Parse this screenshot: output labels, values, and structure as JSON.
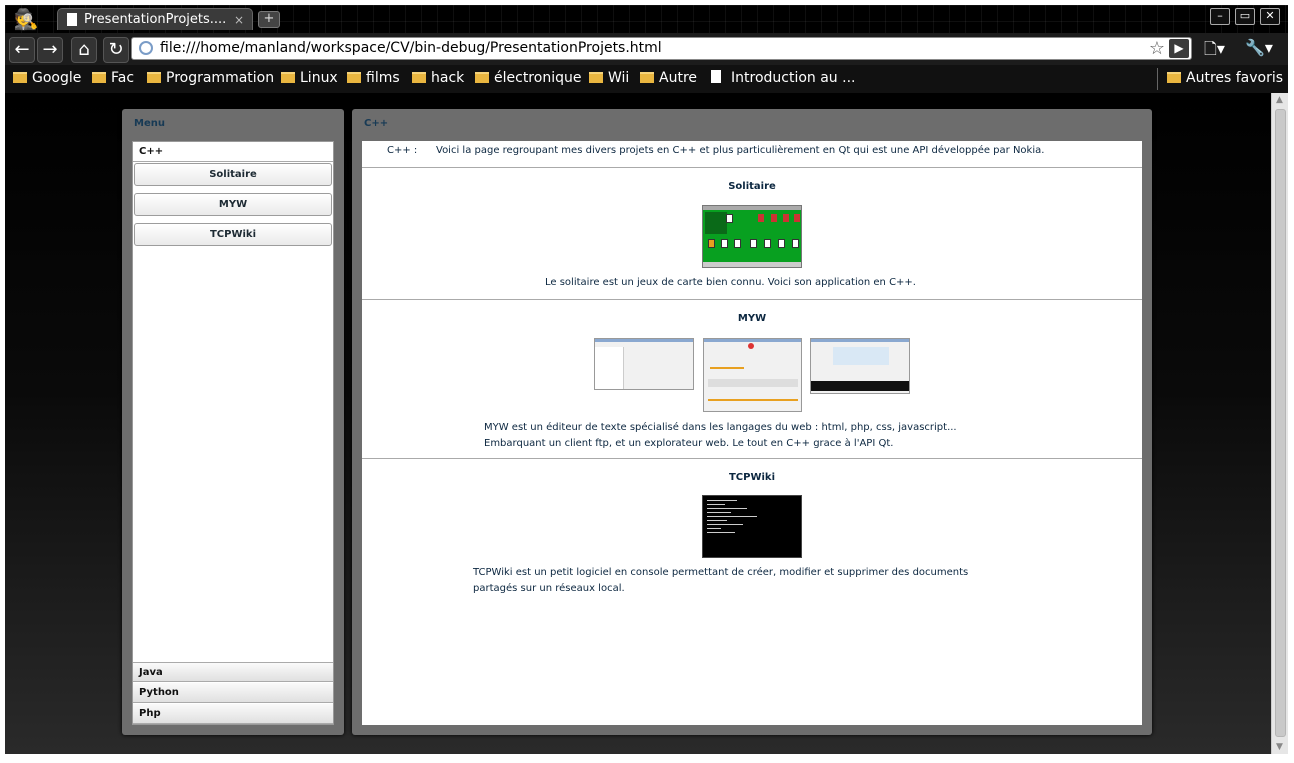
{
  "browser": {
    "tab_title": "PresentationProjets....",
    "tab_close": "×",
    "new_tab": "+",
    "window_buttons": [
      "–",
      "▭",
      "✕"
    ],
    "url": "file:///home/manland/workspace/CV/bin-debug/PresentationProjets.html",
    "bookmarks": [
      "Google",
      "Fac",
      "Programmation",
      "Linux",
      "films",
      "hack",
      "électronique",
      "Wii",
      "Autre",
      "Introduction au ..."
    ],
    "other_bookmarks": "Autres favoris"
  },
  "menu": {
    "title": "Menu",
    "sections": [
      "C++",
      "Java",
      "Python",
      "Php"
    ],
    "cpp_items": [
      "Solitaire",
      "MYW",
      "TCPWiki"
    ]
  },
  "main": {
    "title": "C++",
    "intro_label": "C++ :",
    "intro_text": "Voici la page regroupant mes divers projets en C++ et plus particulièrement en Qt qui est une API développée par Nokia.",
    "projects": [
      {
        "title": "Solitaire",
        "description": [
          "Le solitaire est un jeux de carte bien connu. Voici son application en C++."
        ]
      },
      {
        "title": "MYW",
        "description": [
          "MYW est un éditeur de texte spécialisé dans les langages du web : html, php, css, javascript...",
          "Embarquant un client ftp, et un explorateur web. Le tout en C++ grace à l'API Qt."
        ]
      },
      {
        "title": "TCPWiki",
        "description": [
          "TCPWiki est un petit logiciel en console permettant de créer, modifier et supprimer des documents",
          "partagés sur un réseaux local."
        ]
      }
    ]
  },
  "colors": {
    "panel_bg": "#6d6d6d",
    "text_dark_blue": "#0c2740",
    "solitaire_green": "#08a020"
  },
  "icons": [
    "incognito-icon",
    "back-icon",
    "forward-icon",
    "home-icon",
    "reload-icon",
    "star-icon",
    "go-icon",
    "page-menu-icon",
    "wrench-icon",
    "folder-icon",
    "document-icon"
  ]
}
